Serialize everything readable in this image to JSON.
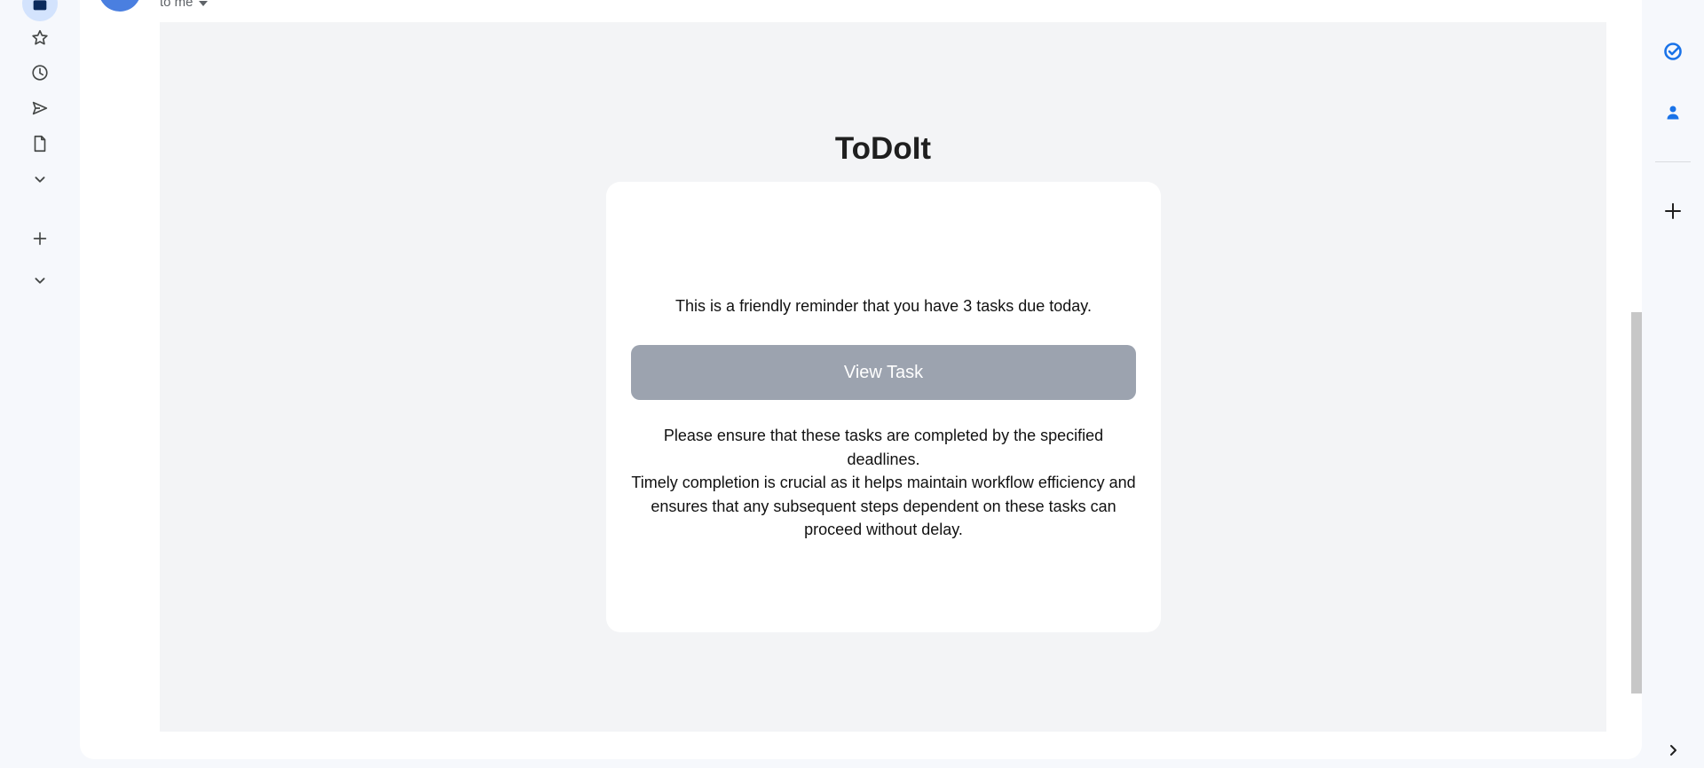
{
  "header": {
    "recipient_label": "to me"
  },
  "email": {
    "brand": "ToDoIt",
    "reminder": "This is a friendly reminder that you have 3 tasks due today.",
    "button_label": "View Task",
    "body_lines": [
      "Please ensure that these tasks are completed by the specified deadlines.",
      "Timely completion is crucial as it helps maintain workflow efficiency and",
      "ensures that any subsequent steps dependent on these tasks can",
      "proceed without delay."
    ]
  },
  "left_rail": {
    "items": [
      {
        "icon": "inbox-icon",
        "active": true
      },
      {
        "icon": "star-icon"
      },
      {
        "icon": "clock-icon"
      },
      {
        "icon": "send-icon"
      },
      {
        "icon": "document-icon"
      },
      {
        "icon": "chevron-down-icon"
      },
      {
        "icon": "plus-icon"
      },
      {
        "icon": "chevron-down-icon"
      }
    ]
  },
  "right_rail": {
    "items": [
      {
        "icon": "tasks-icon"
      },
      {
        "icon": "contacts-icon"
      },
      {
        "icon": "plus-icon"
      },
      {
        "icon": "chevron-right-icon"
      }
    ]
  },
  "colors": {
    "button_bg": "#9ca3af",
    "body_bg": "#f3f4f6",
    "accent": "#1a73e8"
  }
}
